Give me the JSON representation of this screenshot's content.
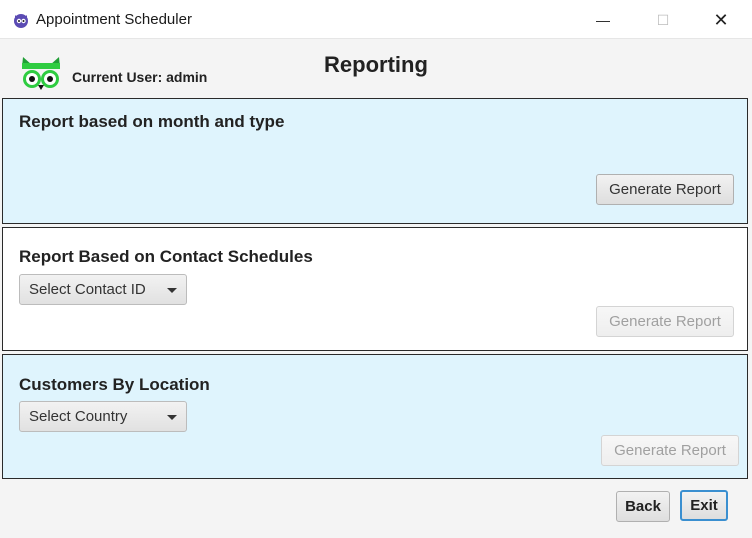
{
  "window": {
    "title": "Appointment Scheduler",
    "minimize_glyph": "—",
    "maximize_glyph": "☐",
    "close_glyph": "✕"
  },
  "header": {
    "current_user": "Current User: admin",
    "page_title": "Reporting"
  },
  "panels": {
    "month_type": {
      "title": "Report based on month and type",
      "button_label": "Generate Report"
    },
    "contact": {
      "title": "Report Based on Contact Schedules",
      "dropdown_label": "Select Contact ID",
      "button_label": "Generate Report"
    },
    "location": {
      "title": "Customers By Location",
      "dropdown_label": "Select Country",
      "button_label": "Generate Report"
    }
  },
  "footer": {
    "back_label": "Back",
    "exit_label": "Exit"
  },
  "colors": {
    "panel_blue": "#dff4fd",
    "logo_green": "#2ecc40",
    "focus_blue": "#3a8fd0"
  },
  "icons": {
    "app_icon": "owl-app-icon",
    "logo": "owl-logo"
  }
}
